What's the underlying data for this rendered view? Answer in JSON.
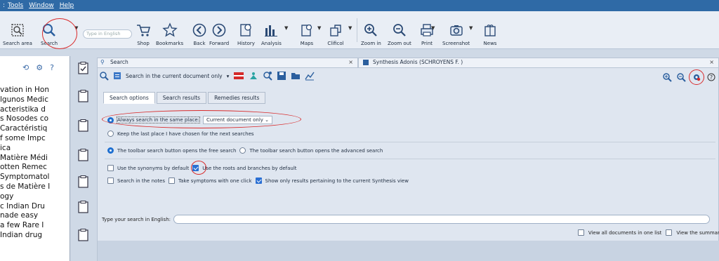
{
  "menu": {
    "items": [
      "Tools",
      "Window",
      "Help"
    ]
  },
  "toolbar": {
    "search_area": "Search area",
    "search": "Search",
    "search_placeholder": "Type in English",
    "shop": "Shop",
    "bookmarks": "Bookmarks",
    "back": "Back",
    "forward": "Forward",
    "history": "History",
    "analysis": "Analysis",
    "maps": "Maps",
    "clificol": "Clificol",
    "zoom_in": "Zoom in",
    "zoom_out": "Zoom out",
    "print": "Print",
    "screenshot": "Screenshot",
    "news": "News"
  },
  "leftlist": [
    "vation in Hon",
    "lgunos Medic",
    "acteristika d",
    "s Nosodes co",
    "Caractéristiq",
    "f some Impc",
    "ica",
    "Matière Médi",
    "otten Remec",
    "Symptomatol",
    "s de Matière I",
    "ogy",
    "c Indian Dru",
    "nade easy",
    "a few Rare I",
    "Indian drug"
  ],
  "tabs": {
    "search": "Search",
    "synthesis": "Synthesis Adonis (SCHROYENS F. )"
  },
  "panel": {
    "scope": "Search in the current document only",
    "subtabs": [
      "Search options",
      "Search results",
      "Remedies results"
    ],
    "opt_same_place": "Always search in the same place:",
    "opt_place_value": "Current document only",
    "opt_keep_last": "Keep the last place I have chosen for the next searches",
    "opt_free_search": "The toolbar search button opens the free search",
    "opt_advanced": "The toolbar search button opens the advanced search",
    "opt_synonyms": "Use the synonyms by default",
    "opt_roots": "Use the roots and branches by default",
    "opt_notes": "Search in the notes",
    "opt_take_symptoms": "Take symptoms with one click",
    "opt_show_only": "Show only results pertaining to the current Synthesis view",
    "type_label": "Type your search in English:",
    "view_all": "View all documents in one list",
    "view_summary": "View the summary"
  }
}
